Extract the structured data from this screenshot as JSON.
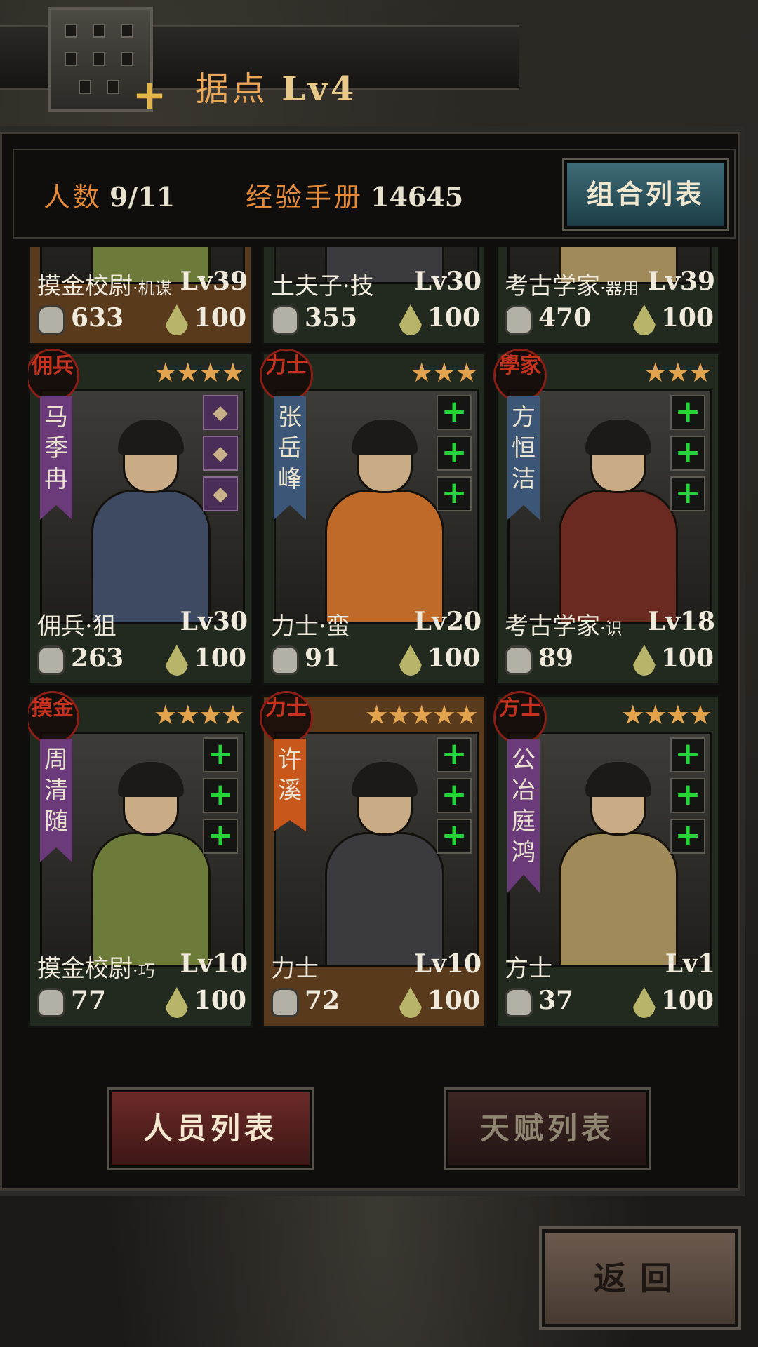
{
  "header": {
    "title": "据点",
    "level": "Lv4"
  },
  "stats": {
    "population_label": "人数",
    "population_value": "9/11",
    "exp_label": "经验手册",
    "exp_value": "14645",
    "combo_button": "组合列表"
  },
  "cards": [
    {
      "job": "摸金校尉",
      "sub": "·机谋",
      "lvl": "Lv39",
      "power": "633",
      "energy": "100",
      "gold": true
    },
    {
      "job": "土夫子·技",
      "sub": "",
      "lvl": "Lv30",
      "power": "355",
      "energy": "100"
    },
    {
      "job": "考古学家",
      "sub": "·器用",
      "lvl": "Lv39",
      "power": "470",
      "energy": "100"
    },
    {
      "seal": "佣兵",
      "name": "马季冉",
      "stars": "★★★★",
      "job": "佣兵·狙",
      "sub": "",
      "lvl": "Lv30",
      "power": "263",
      "energy": "100",
      "banner": "#6b3a7a"
    },
    {
      "seal": "力士",
      "name": "张岳峰",
      "stars": "★★★",
      "job": "力士·蛮",
      "sub": "",
      "lvl": "Lv20",
      "power": "91",
      "energy": "100",
      "banner": "#3b5676"
    },
    {
      "seal": "學家",
      "name": "方恒洁",
      "stars": "★★★",
      "job": "考古学家",
      "sub": "·识",
      "lvl": "Lv18",
      "power": "89",
      "energy": "100",
      "banner": "#3b5676"
    },
    {
      "seal": "摸金",
      "name": "周清随",
      "stars": "★★★★",
      "job": "摸金校尉",
      "sub": "·巧",
      "lvl": "Lv10",
      "power": "77",
      "energy": "100",
      "banner": "#6b3a7a"
    },
    {
      "seal": "力士",
      "name": "许溪",
      "stars": "★★★★★",
      "job": "力士",
      "sub": "",
      "lvl": "Lv10",
      "power": "72",
      "energy": "100",
      "banner": "#c8571c",
      "gold": true
    },
    {
      "seal": "方士",
      "name": "公冶庭鸿",
      "stars": "★★★★",
      "job": "方士",
      "sub": "",
      "lvl": "Lv1",
      "power": "37",
      "energy": "100",
      "banner": "#6b3a7a"
    }
  ],
  "tabs": {
    "personnel": "人员列表",
    "talent": "天赋列表"
  },
  "back": "返回",
  "colors": {
    "accent_orange": "#e48a38",
    "gold_star": "#e2a44e",
    "plus_green": "#26d33a"
  }
}
